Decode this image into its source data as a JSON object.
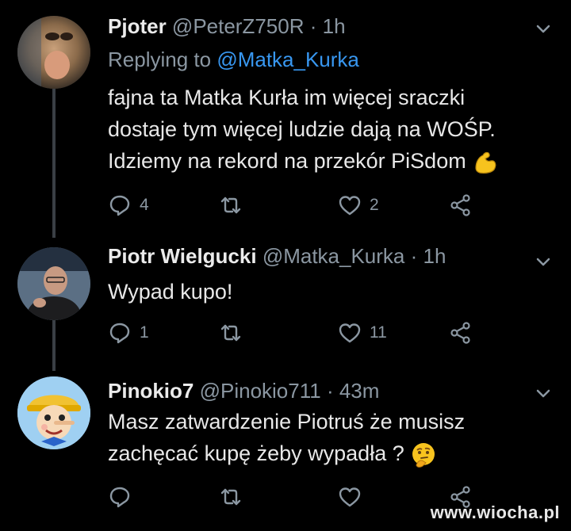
{
  "tweets": [
    {
      "name": "Pjoter",
      "handle": "@PeterZ750R",
      "time": "· 1h",
      "reply_prefix": "Replying to ",
      "reply_handle": "@Matka_Kurka",
      "lines": [
        "fajna ta Matka Kurła im więcej sraczki",
        "dostaje tym więcej ludzie dają na WOŚP.",
        "Idziemy na rekord na przekór PiSdom"
      ],
      "emoji": "flexed-biceps-emoji",
      "reply_count": "4",
      "retweet_count": "",
      "like_count": "2"
    },
    {
      "name": "Piotr Wielgucki",
      "handle": "@Matka_Kurka",
      "time": "· 1h",
      "lines": [
        "Wypad kupo!"
      ],
      "reply_count": "1",
      "retweet_count": "",
      "like_count": "11"
    },
    {
      "name": "Pinokio7",
      "handle": "@Pinokio711",
      "time": "· 43m",
      "lines": [
        "Masz zatwardzenie Piotruś że musisz",
        "zachęcać kupę żeby wypadła ?"
      ],
      "emoji": "thinking-face-emoji",
      "reply_count": "",
      "retweet_count": "",
      "like_count": ""
    }
  ],
  "watermark": "www.wiocha.pl",
  "colors": {
    "background": "#000000",
    "name": "#ebebeb",
    "meta": "#8b97a2",
    "link": "#3897f0",
    "icon": "#8b97a2"
  }
}
